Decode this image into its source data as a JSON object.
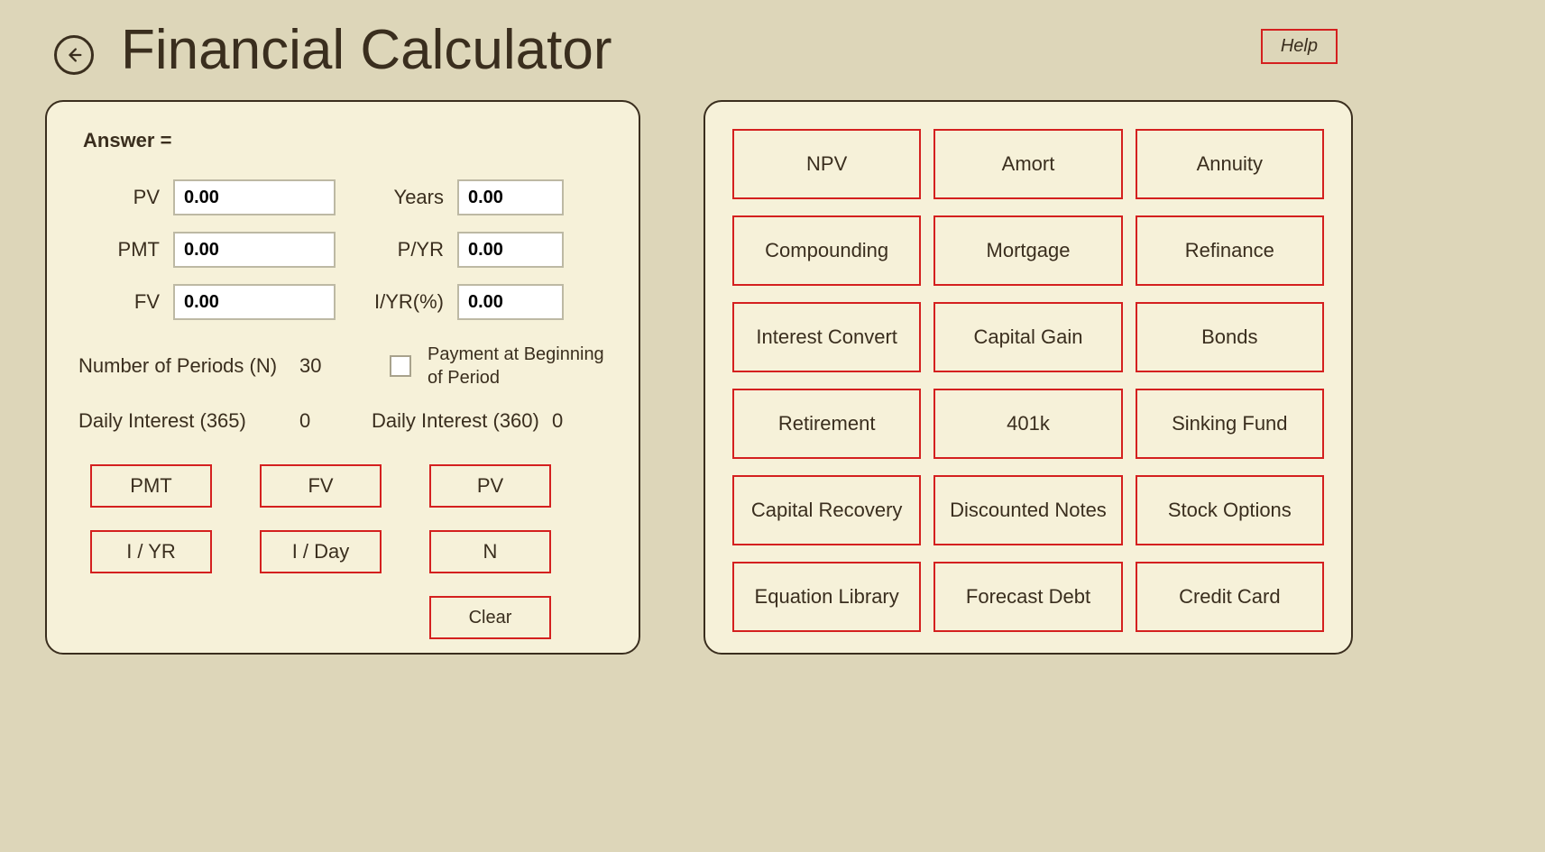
{
  "header": {
    "title": "Financial Calculator",
    "help_label": "Help"
  },
  "inputs": {
    "answer_label": "Answer =",
    "pv_label": "PV",
    "pv_value": "0.00",
    "pmt_label": "PMT",
    "pmt_value": "0.00",
    "fv_label": "FV",
    "fv_value": "0.00",
    "years_label": "Years",
    "years_value": "0.00",
    "pyr_label": "P/YR",
    "pyr_value": "0.00",
    "iyr_label": "I/YR(%)",
    "iyr_value": "0.00",
    "periods_label": "Number of Periods  (N)",
    "periods_value": "30",
    "begin_checkbox_label": "Payment at Beginning of Period",
    "daily365_label": "Daily Interest (365)",
    "daily365_value": "0",
    "daily360_label": "Daily Interest (360)",
    "daily360_value": "0"
  },
  "calc_buttons": {
    "pmt": "PMT",
    "fv": "FV",
    "pv": "PV",
    "iyr": "I / YR",
    "iday": "I / Day",
    "n": "N",
    "clear": "Clear"
  },
  "tools": [
    [
      "NPV",
      "Amort",
      "Annuity"
    ],
    [
      "Compounding",
      "Mortgage",
      "Refinance"
    ],
    [
      "Interest Convert",
      "Capital Gain",
      "Bonds"
    ],
    [
      "Retirement",
      "401k",
      "Sinking Fund"
    ],
    [
      "Capital Recovery",
      "Discounted Notes",
      "Stock Options"
    ],
    [
      "Equation Library",
      "Forecast Debt",
      "Credit Card"
    ]
  ]
}
